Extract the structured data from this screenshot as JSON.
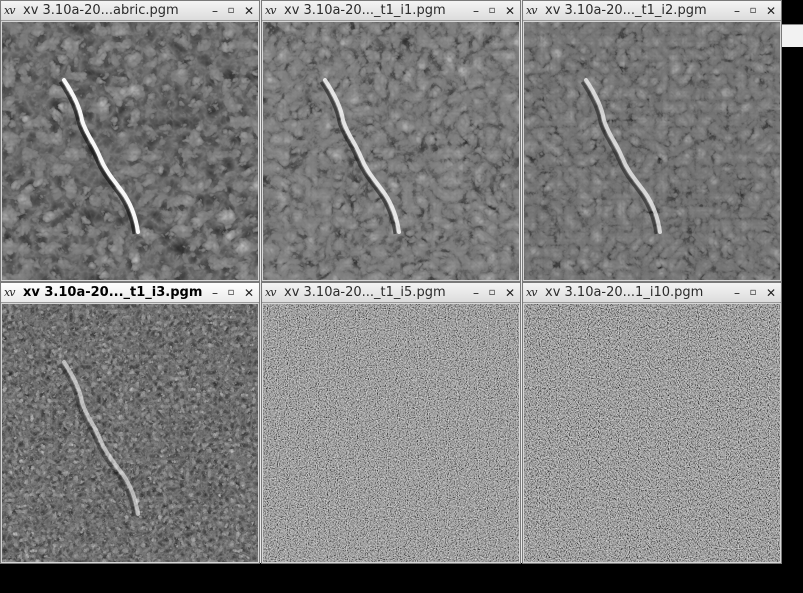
{
  "windows": [
    {
      "title": "xv 3.10a-20...abric.pgm",
      "icon": "xv-icon",
      "active": false,
      "contrast": 1.3,
      "noise": 0.06,
      "trail": 0.95,
      "base_tone": "#7a7a7a"
    },
    {
      "title": "xv 3.10a-20..._t1_i1.pgm",
      "icon": "xv-icon",
      "active": false,
      "contrast": 0.9,
      "noise": 0.08,
      "trail": 0.8,
      "base_tone": "#7e7e7e"
    },
    {
      "title": "xv 3.10a-20..._t1_i2.pgm",
      "icon": "xv-icon",
      "active": false,
      "contrast": 0.8,
      "noise": 0.09,
      "trail": 0.7,
      "base_tone": "#747474"
    },
    {
      "title": "xv 3.10a-20..._t1_i3.pgm",
      "icon": "xv-icon",
      "active": true,
      "contrast": 1.6,
      "noise": 0.35,
      "trail": 0.55,
      "base_tone": "#808080"
    },
    {
      "title": "xv 3.10a-20..._t1_i5.pgm",
      "icon": "xv-icon",
      "active": false,
      "contrast": 2.2,
      "noise": 0.85,
      "trail": 0.0,
      "base_tone": "#8a8a8a"
    },
    {
      "title": "xv 3.10a-20...1_i10.pgm",
      "icon": "xv-icon",
      "active": false,
      "contrast": 2.4,
      "noise": 0.95,
      "trail": 0.0,
      "base_tone": "#8a8a8a"
    }
  ],
  "controls": {
    "minimize": "–",
    "maximize": "▫",
    "close": "✕",
    "icon_glyph": "xv"
  }
}
